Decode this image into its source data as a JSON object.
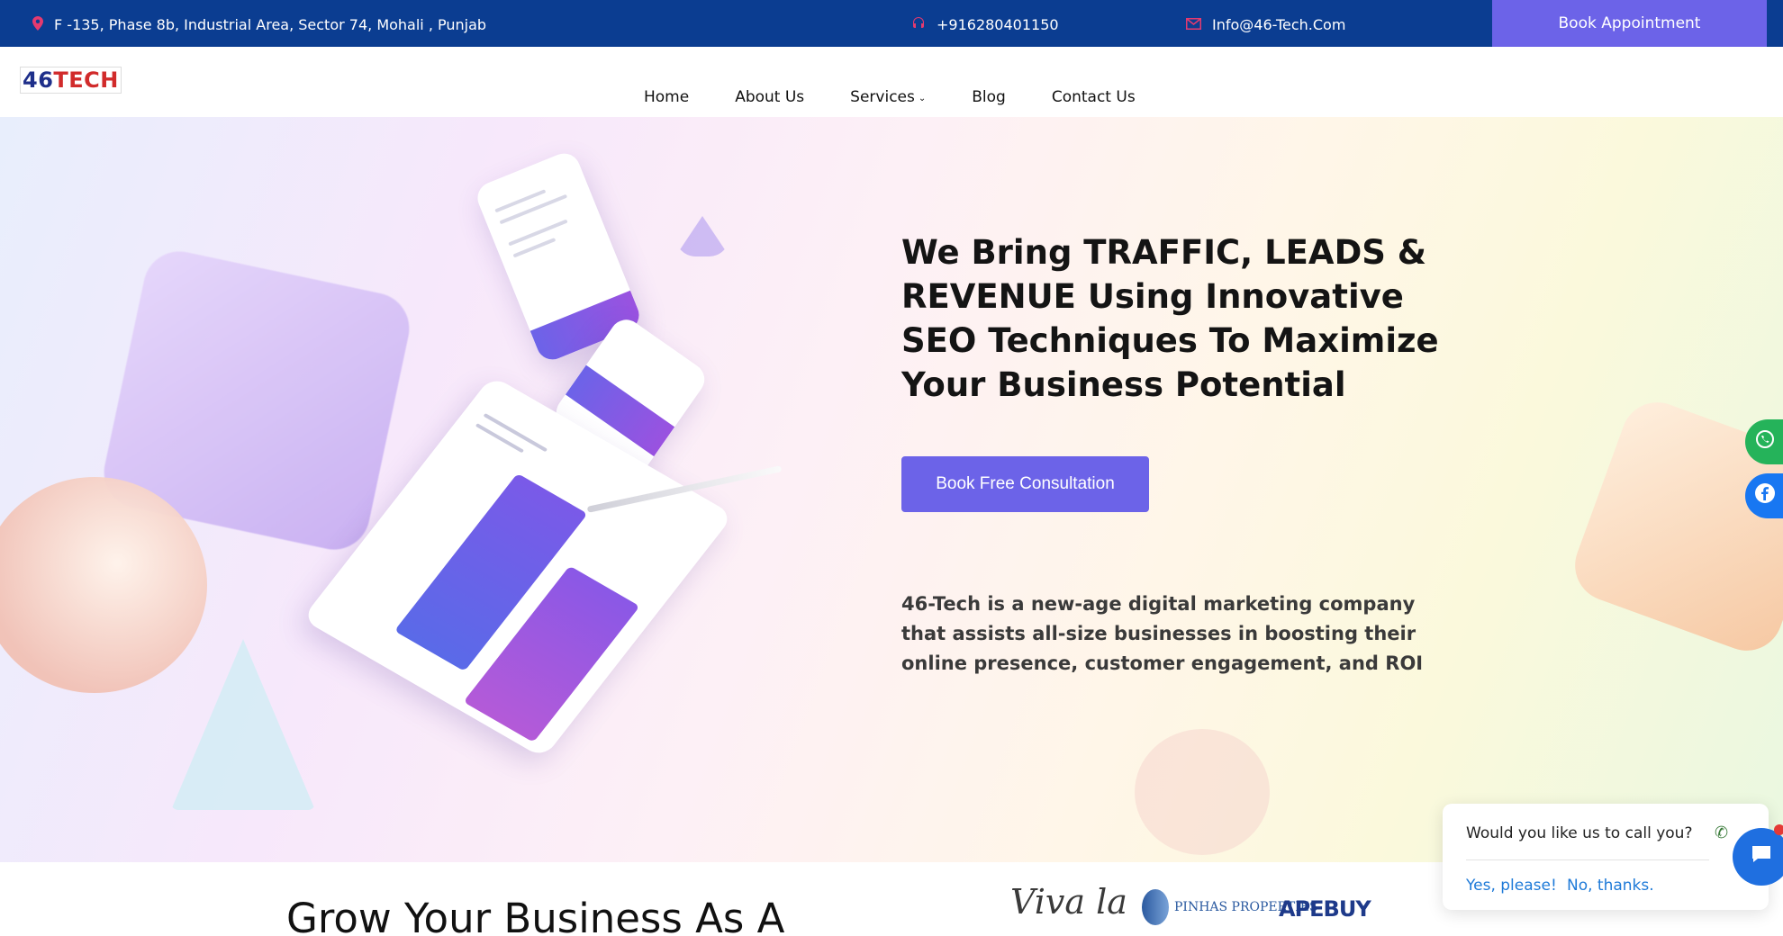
{
  "topbar": {
    "address": "F -135, Phase 8b, Industrial Area, Sector 74, Mohali , Punjab",
    "phone": "+916280401150",
    "email": "Info@46-Tech.Com",
    "book_label": "Book Appointment",
    "icons": {
      "address": "location-pin-icon",
      "phone": "headset-icon",
      "email": "mail-icon"
    },
    "colors": {
      "bar": "#0b3d91",
      "book": "#6c63e8",
      "icon": "#e53a6f"
    }
  },
  "header": {
    "logo_num": "46",
    "logo_text": "TECH",
    "nav": [
      {
        "label": "Home"
      },
      {
        "label": "About Us"
      },
      {
        "label": "Services"
      },
      {
        "label": "Blog"
      },
      {
        "label": "Contact Us"
      }
    ]
  },
  "hero": {
    "title": "We Bring TRAFFIC, LEADS & REVENUE Using Innovative SEO Techniques To Maximize Your Business Potential",
    "cta_label": "Book Free Consultation",
    "description": "46-Tech is a new-age digital marketing company that assists all-size businesses in boosting their online presence, customer engagement, and ROI",
    "accent": "#6c63e8"
  },
  "social": {
    "whatsapp_icon": "whatsapp-icon",
    "facebook_icon": "facebook-icon"
  },
  "bottom": {
    "heading": "Grow Your Business As A",
    "partners": [
      "Viva la",
      "PINHAS PROPERTIES",
      "APEBUY"
    ]
  },
  "chat": {
    "question": "Would you like us to call you?",
    "yes_label": "Yes, please!",
    "no_label": "No, thanks."
  }
}
